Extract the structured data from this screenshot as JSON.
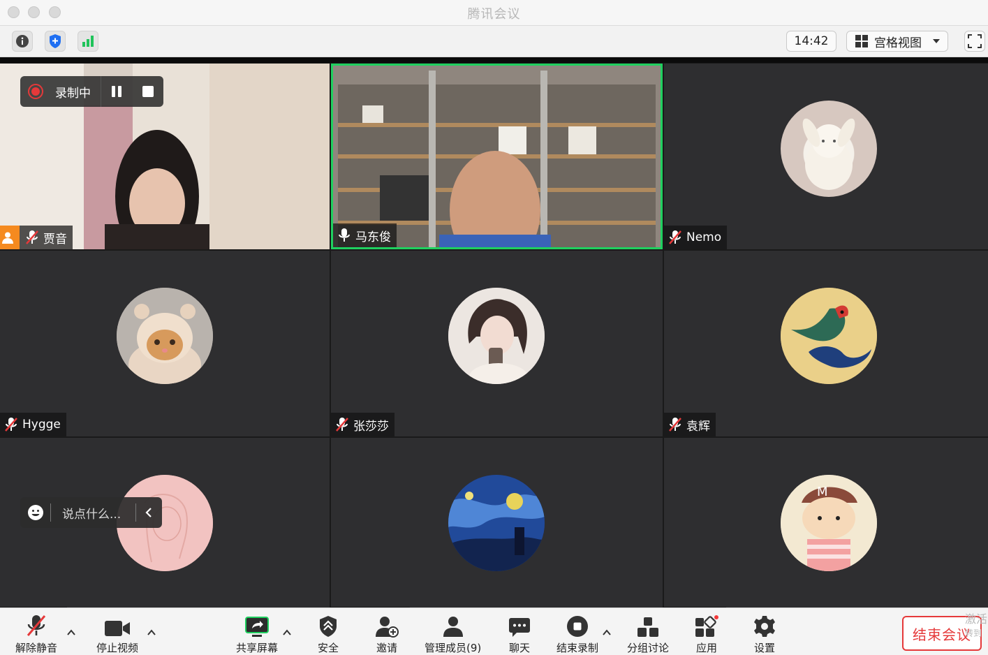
{
  "window": {
    "title": "腾讯会议"
  },
  "toolbar": {
    "time": "14:42",
    "view_label": "宫格视图"
  },
  "recording": {
    "label": "录制中"
  },
  "participants": [
    {
      "name": "贾音",
      "muted": true,
      "host": true,
      "speaking": false
    },
    {
      "name": "马东俊",
      "muted": false,
      "host": false,
      "speaking": true
    },
    {
      "name": "Nemo",
      "muted": true,
      "host": false,
      "speaking": false
    },
    {
      "name": "Hygge",
      "muted": true,
      "host": false,
      "speaking": false
    },
    {
      "name": "张莎莎",
      "muted": true,
      "host": false,
      "speaking": false
    },
    {
      "name": "袁辉",
      "muted": true,
      "host": false,
      "speaking": false
    }
  ],
  "chat": {
    "placeholder": "说点什么..."
  },
  "bottom_bar": {
    "unmute": "解除静音",
    "stop_video": "停止视频",
    "share_screen": "共享屏幕",
    "security": "安全",
    "invite": "邀请",
    "manage_members": "管理成员(9)",
    "chat": "聊天",
    "end_recording": "结束录制",
    "breakout": "分组讨论",
    "apps": "应用",
    "settings": "设置",
    "end_meeting": "结束会议"
  },
  "watermark": {
    "line1": "激活",
    "line2": "转到"
  },
  "colors": {
    "accent_green": "#1fd05f",
    "end_red": "#e5393a",
    "tile_bg": "#2e2e30",
    "brand_blue": "#1f6ff2"
  }
}
